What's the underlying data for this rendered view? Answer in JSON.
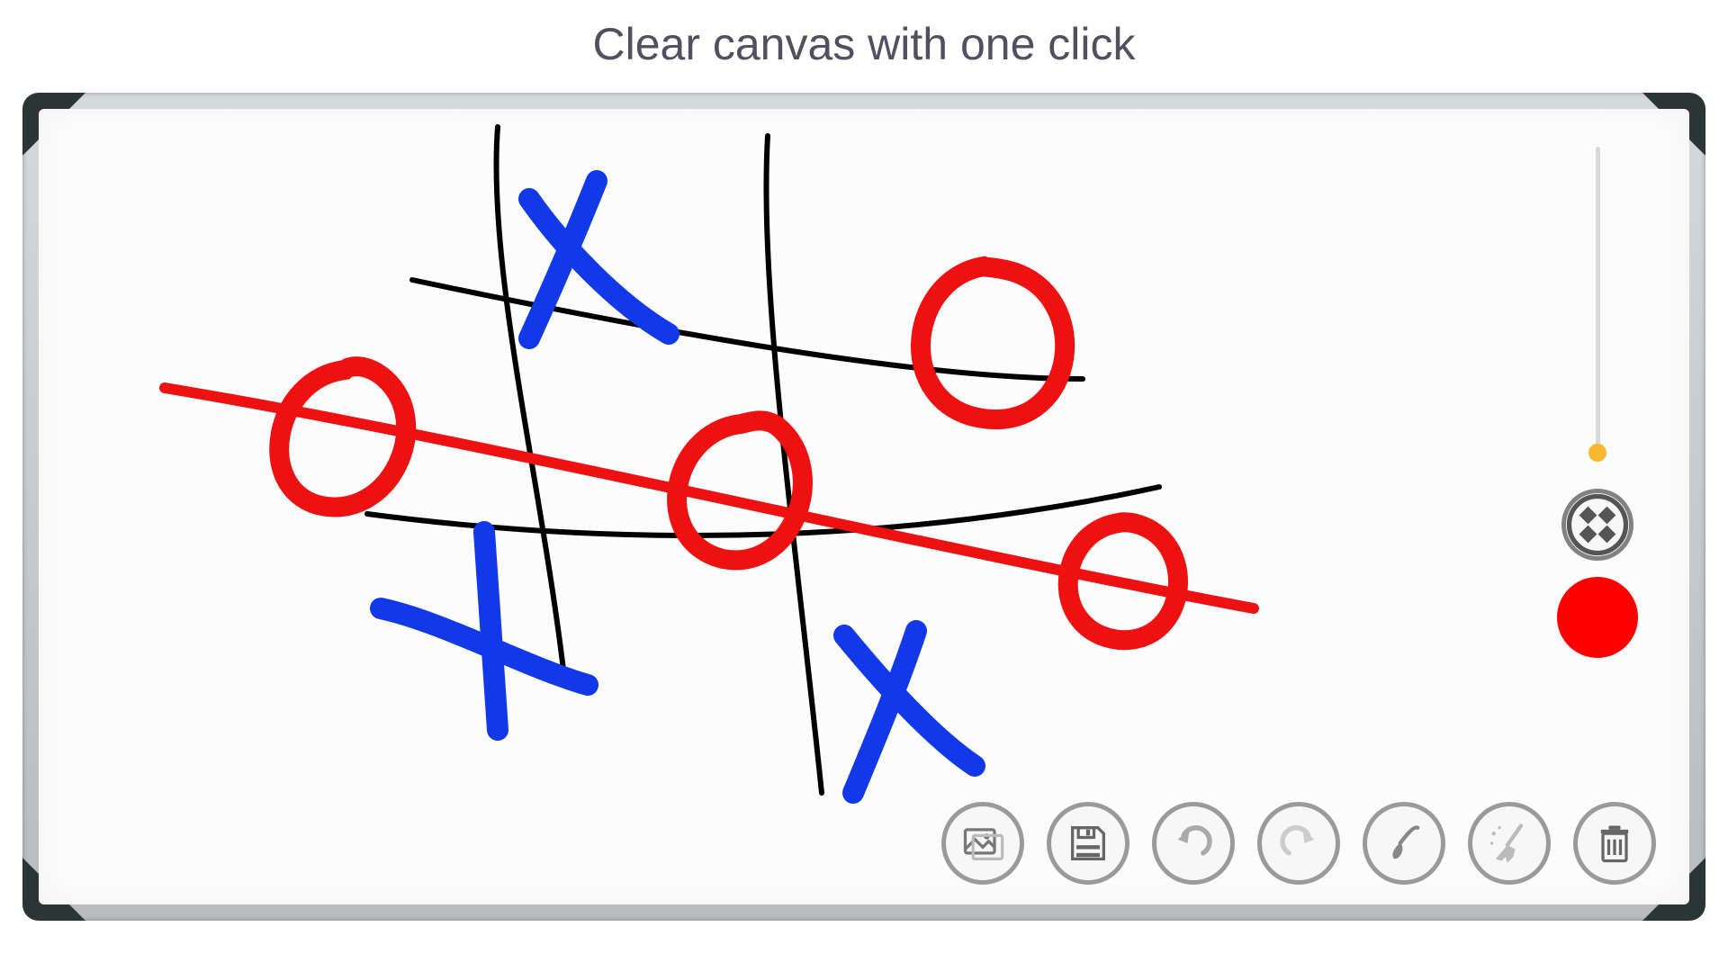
{
  "page": {
    "title": "Clear canvas with one click"
  },
  "colors": {
    "grid_stroke": "#000000",
    "x_stroke": "#1239e8",
    "o_stroke": "#ee1111",
    "strike_stroke": "#ee1111",
    "current_brush": "#ff0000",
    "slider_thumb": "#f7b82e"
  },
  "slider": {
    "value_pct": 0
  },
  "side": {
    "shapes_label": "shapes"
  },
  "toolbar": {
    "image": "image",
    "save": "save",
    "undo": "undo",
    "redo": "redo",
    "brush": "brush",
    "clear": "clear",
    "trash": "trash"
  }
}
